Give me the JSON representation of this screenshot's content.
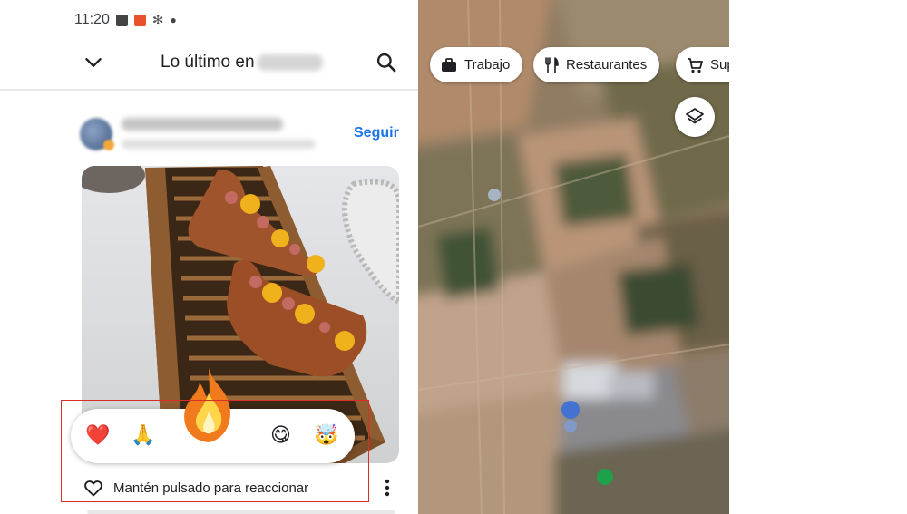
{
  "status_bar": {
    "time": "11:20"
  },
  "header": {
    "title": "Lo último en",
    "back_icon": "chevron-down-icon",
    "search_icon": "search-icon"
  },
  "post": {
    "follow_label": "Seguir"
  },
  "reactions": {
    "emojis": [
      "❤️",
      "🙏",
      "😋",
      "🤯"
    ],
    "highlighted": "🔥",
    "hint_text": "Mantén pulsado para reaccionar",
    "box_color": "#d93025"
  },
  "map": {
    "chips": [
      {
        "label": "Trabajo",
        "icon": "briefcase-icon"
      },
      {
        "label": "Restaurantes",
        "icon": "fork-knife-icon"
      },
      {
        "label": "Sup",
        "icon": "shopping-cart-icon"
      }
    ],
    "layers_icon": "layers-icon"
  },
  "colors": {
    "accent": "#1a73e8",
    "highlight_box": "#d93025"
  }
}
